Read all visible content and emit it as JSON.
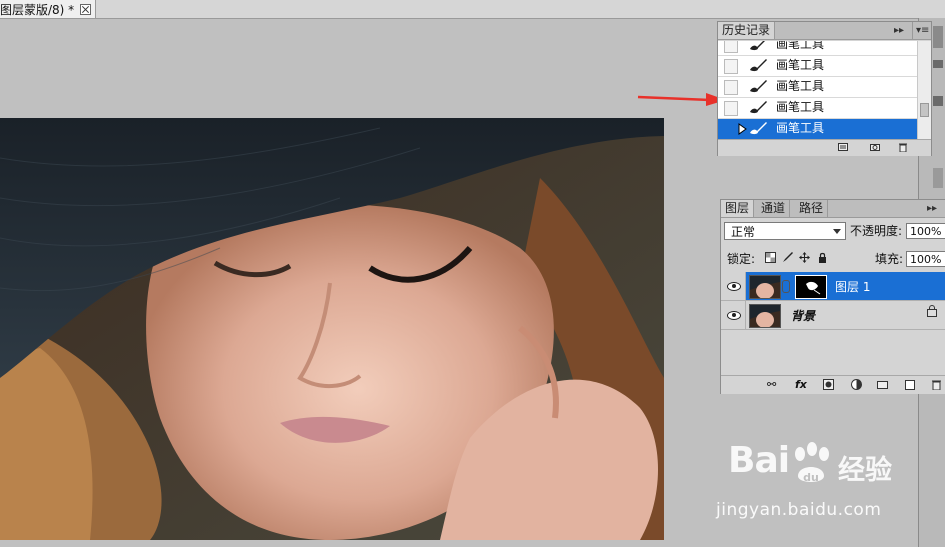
{
  "document": {
    "tab_title": "图层蒙版/8) *",
    "close_icon": "close-icon"
  },
  "history_panel": {
    "tab_label": "历史记录",
    "menu_icons": [
      "collapse-icon",
      "panel-menu-icon"
    ],
    "items": [
      {
        "label": "画笔工具",
        "selected": false
      },
      {
        "label": "画笔工具",
        "selected": false
      },
      {
        "label": "画笔工具",
        "selected": false
      },
      {
        "label": "画笔工具",
        "selected": false
      },
      {
        "label": "画笔工具",
        "selected": true
      }
    ],
    "item_icon": "brush-icon",
    "footer_icons": [
      "new-document-from-state-icon",
      "snapshot-icon",
      "trash-icon"
    ]
  },
  "layers_panel": {
    "tabs": [
      "图层",
      "通道",
      "路径"
    ],
    "active_tab": "图层",
    "blend_mode": "正常",
    "opacity_label": "不透明度:",
    "opacity_value": "100%",
    "lock_label": "锁定:",
    "fill_label": "填充:",
    "fill_value": "100%",
    "layers": [
      {
        "name": "图层 1",
        "selected": true,
        "has_mask": true,
        "locked": false
      },
      {
        "name": "背景",
        "selected": false,
        "has_mask": false,
        "locked": true
      }
    ],
    "footer_icons": [
      "link-icon",
      "fx-icon",
      "mask-icon",
      "adjustment-icon",
      "group-folder-icon",
      "new-layer-icon",
      "trash-icon"
    ]
  },
  "watermark": {
    "brand": "Bai",
    "brand_cn": "经验",
    "url": "jingyan.baidu.com"
  },
  "colors": {
    "selection": "#1a6fd4",
    "arrow": "#e8312a",
    "canvas_bg": "#c0c0c0",
    "panel_bg": "#d4d4d4"
  }
}
